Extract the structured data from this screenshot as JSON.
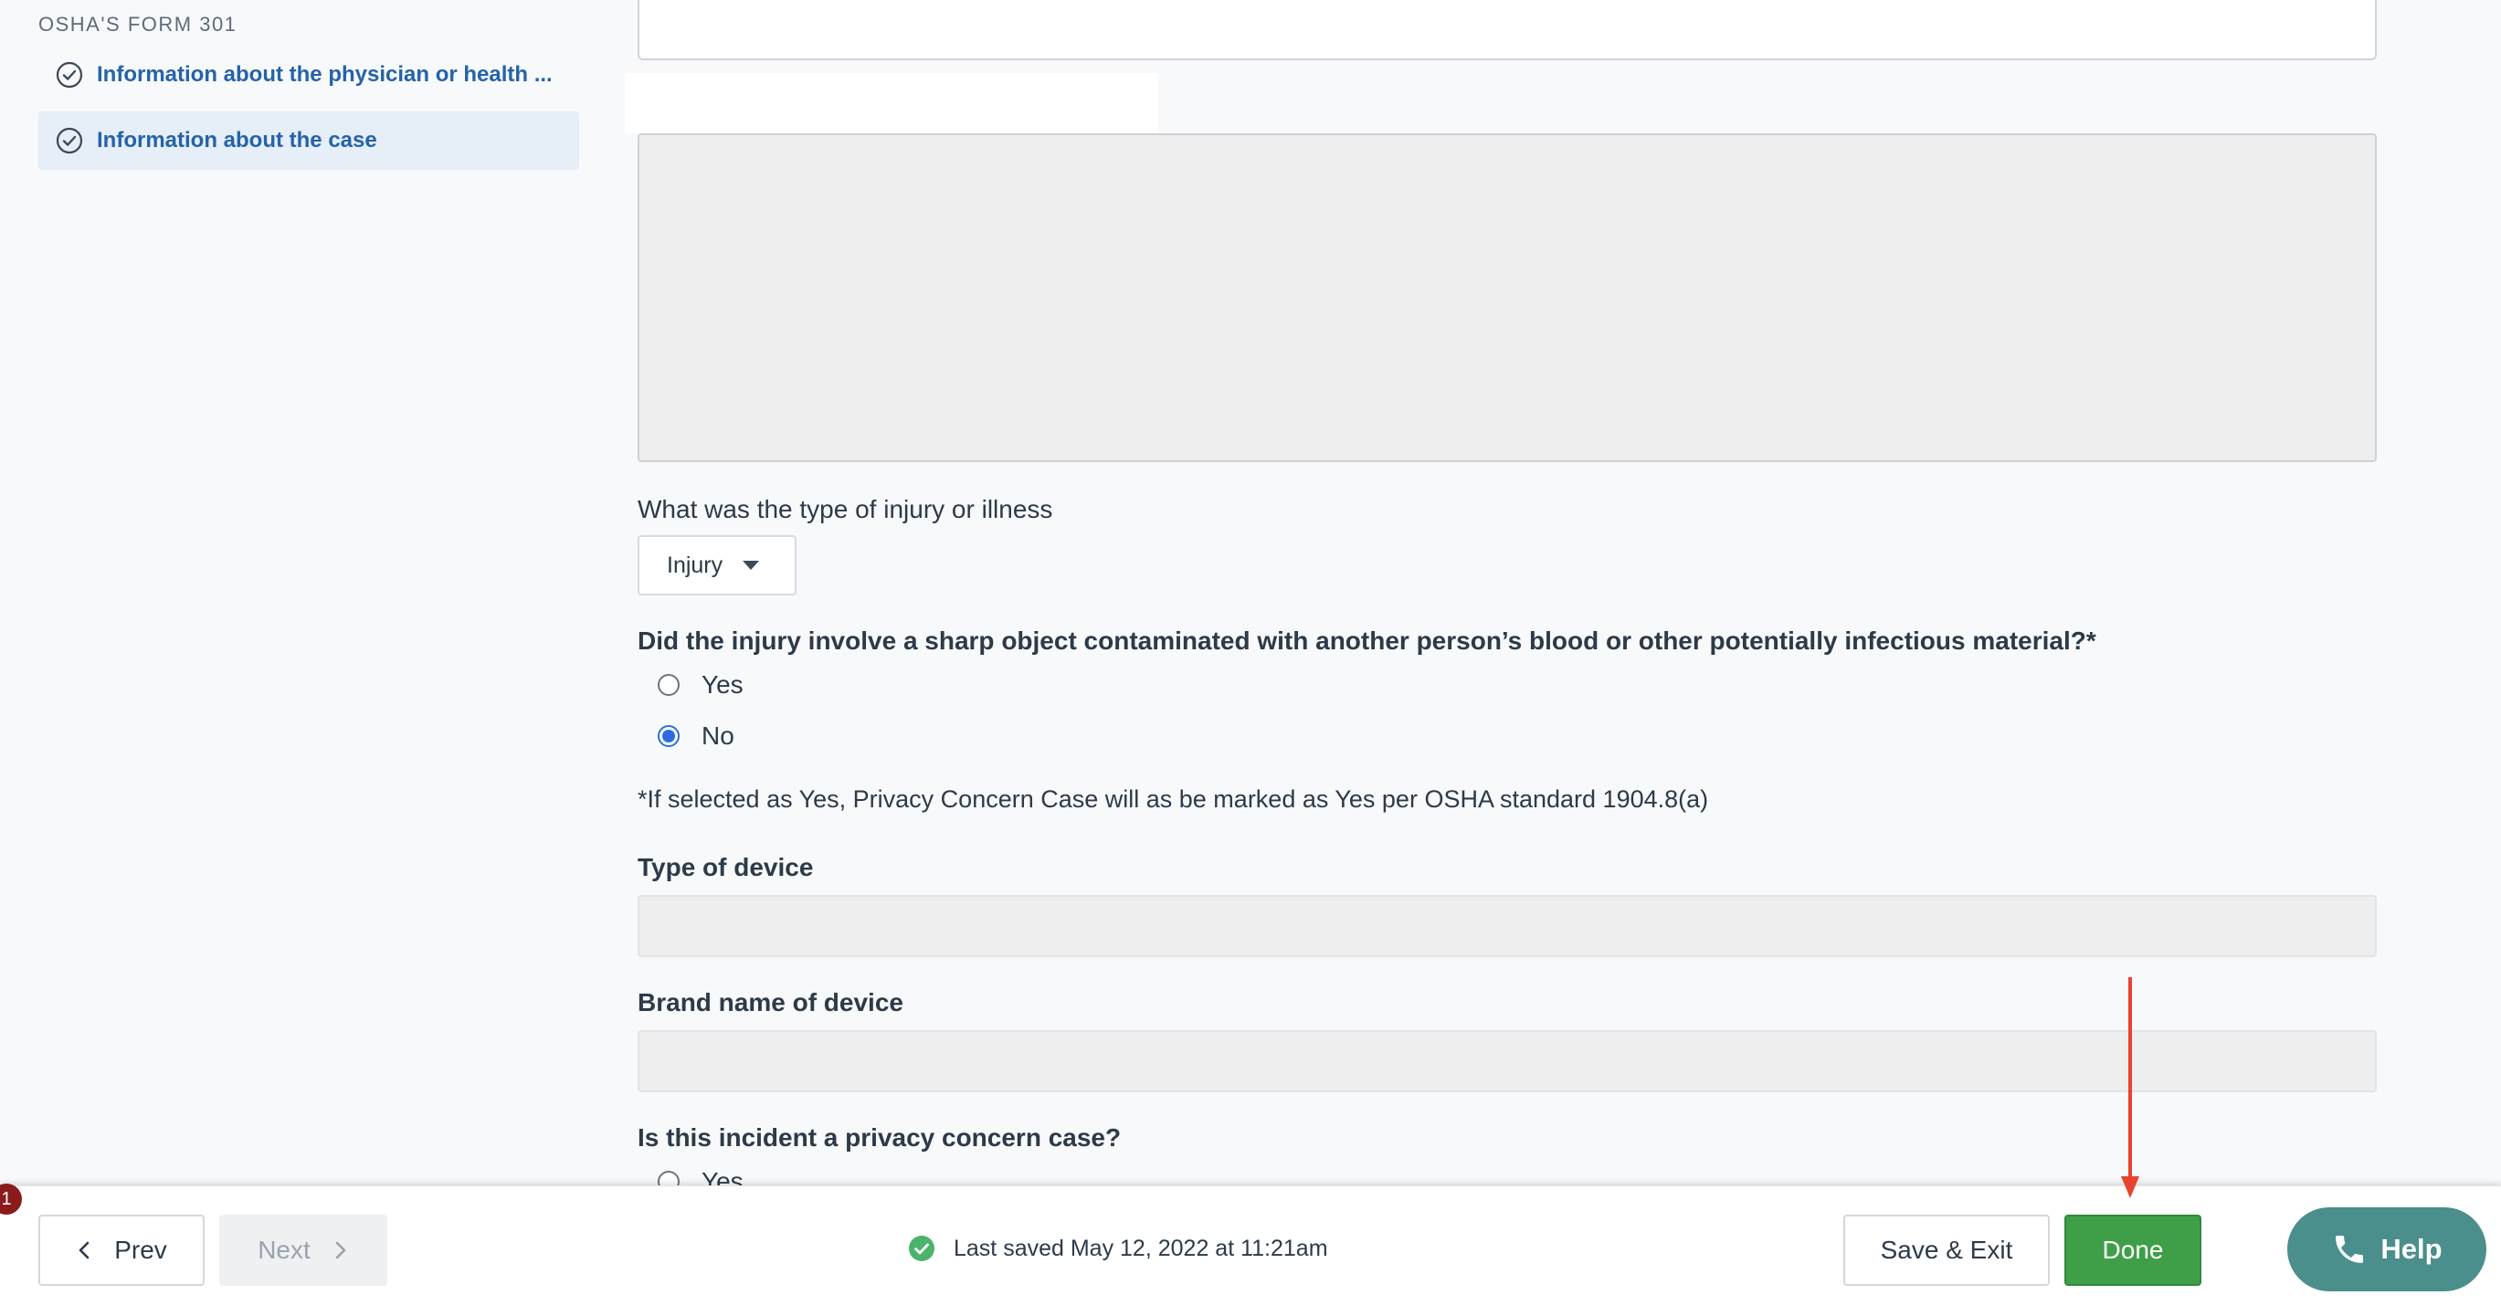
{
  "sidebar": {
    "section_heading": "OSHA'S FORM 301",
    "items": [
      {
        "label": "Information about the physician or health ...",
        "icon": "check-circle-icon"
      },
      {
        "label": "Information about the case",
        "icon": "check-circle-icon"
      }
    ]
  },
  "form": {
    "injury_type": {
      "label": "What was the type of injury or illness",
      "selected": "Injury"
    },
    "sharp_object": {
      "label": "Did the injury involve a sharp object contaminated with another person’s blood or other potentially infectious material?*",
      "options": [
        "Yes",
        "No"
      ],
      "selected": "No"
    },
    "note": "*If selected as Yes, Privacy Concern Case will as be marked as Yes per OSHA standard 1904.8(a)",
    "device_type": {
      "label": "Type of device",
      "value": ""
    },
    "device_brand": {
      "label": "Brand name of device",
      "value": ""
    },
    "privacy_concern": {
      "label": "Is this incident a privacy concern case?",
      "options": [
        "Yes"
      ]
    }
  },
  "footer": {
    "badge": "1",
    "prev_label": "Prev",
    "next_label": "Next",
    "saved_text": "Last saved May 12, 2022 at 11:21am",
    "save_exit_label": "Save & Exit",
    "done_label": "Done",
    "help_label": "Help"
  },
  "colors": {
    "accent_blue": "#2563a8",
    "done_green": "#3f9f48",
    "help_teal": "#4a8f8c",
    "annotation_red": "#e8432e"
  }
}
